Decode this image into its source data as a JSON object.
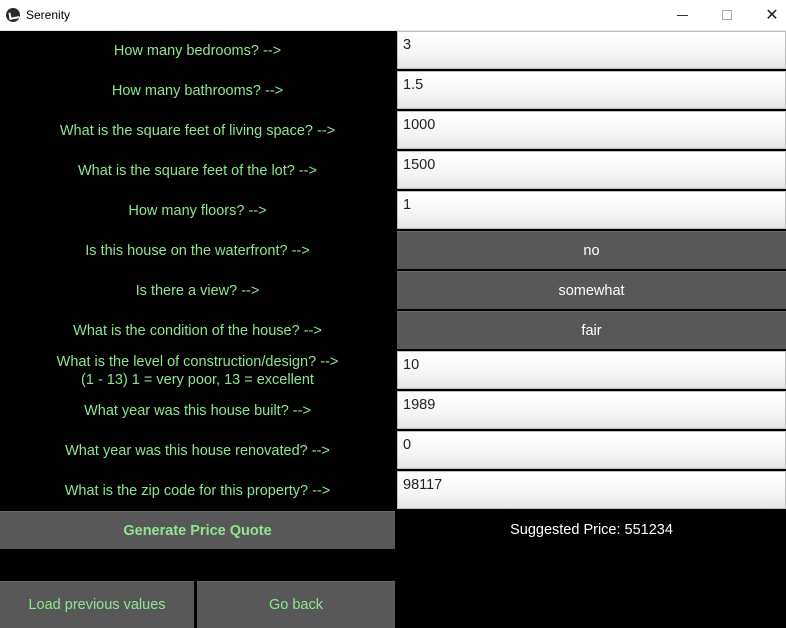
{
  "window": {
    "title": "Serenity",
    "icon": "kivy-app-icon",
    "close_glyph": "✕"
  },
  "form": {
    "fields": [
      {
        "label": "How many bedrooms? -->",
        "value": "3"
      },
      {
        "label": "How many bathrooms? -->",
        "value": "1.5"
      },
      {
        "label": "What is the square feet of living space? -->",
        "value": "1000"
      },
      {
        "label": "What is the square feet of the lot? -->",
        "value": "1500"
      },
      {
        "label": "How many floors? -->",
        "value": "1"
      },
      {
        "label": "Is this house on the waterfront? -->",
        "value": "no"
      },
      {
        "label": "Is there a view? -->",
        "value": "somewhat"
      },
      {
        "label": "What is the condition of the house? -->",
        "value": "fair"
      },
      {
        "label": "What is the level of construction/design? -->",
        "label_line2": "(1 - 13) 1 = very poor, 13 = excellent",
        "value": "10"
      },
      {
        "label": "What year was this house built? -->",
        "value": "1989"
      },
      {
        "label": "What year was this house renovated? -->",
        "value": "0"
      },
      {
        "label": "What is the zip code for this property? -->",
        "value": "98117"
      }
    ]
  },
  "actions": {
    "generate_label": "Generate Price Quote",
    "result_text": "Suggested Price: 551234",
    "load_label": "Load previous values",
    "back_label": "Go back"
  },
  "colors": {
    "background": "#000000",
    "label_green": "#8fe58f",
    "button_gray": "#585858"
  }
}
